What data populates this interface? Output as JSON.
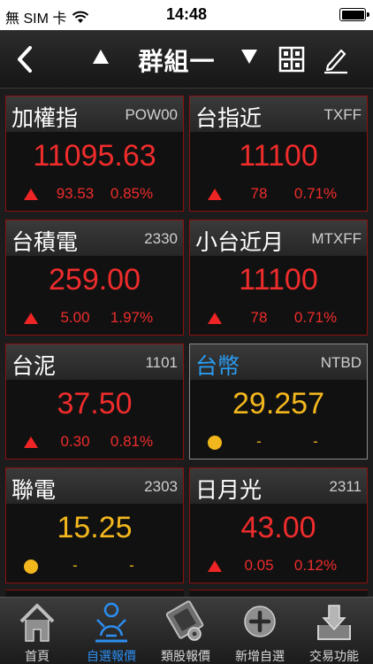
{
  "status_bar": {
    "carrier": "無 SIM 卡",
    "time": "14:48"
  },
  "nav": {
    "title": "群組一"
  },
  "cards": [
    {
      "name": "加權指",
      "code": "POW00",
      "price": "11095.63",
      "change": "93.53",
      "percent": "0.85%",
      "direction": "up"
    },
    {
      "name": "台指近",
      "code": "TXFF",
      "price": "11100",
      "change": "78",
      "percent": "0.71%",
      "direction": "up"
    },
    {
      "name": "台積電",
      "code": "2330",
      "price": "259.00",
      "change": "5.00",
      "percent": "1.97%",
      "direction": "up"
    },
    {
      "name": "小台近月",
      "code": "MTXFF",
      "price": "11100",
      "change": "78",
      "percent": "0.71%",
      "direction": "up"
    },
    {
      "name": "台泥",
      "code": "1101",
      "price": "37.50",
      "change": "0.30",
      "percent": "0.81%",
      "direction": "up"
    },
    {
      "name": "台幣",
      "code": "NTBD",
      "price": "29.257",
      "change": "-",
      "percent": "-",
      "direction": "flat"
    },
    {
      "name": "聯電",
      "code": "2303",
      "price": "15.25",
      "change": "-",
      "percent": "-",
      "direction": "flat"
    },
    {
      "name": "日月光",
      "code": "2311",
      "price": "43.00",
      "change": "0.05",
      "percent": "0.12%",
      "direction": "up"
    }
  ],
  "tabs": [
    {
      "label": "首頁",
      "icon": "home-icon"
    },
    {
      "label": "自選報價",
      "icon": "watchlist-person-icon"
    },
    {
      "label": "類股報價",
      "icon": "film-reel-icon"
    },
    {
      "label": "新增自選",
      "icon": "add-circle-icon"
    },
    {
      "label": "交易功能",
      "icon": "download-tray-icon"
    }
  ],
  "colors": {
    "up": "#ef2c2c",
    "flat": "#f3b71e",
    "active_tab": "#2c8ef0",
    "card_border": "#8c1010"
  }
}
